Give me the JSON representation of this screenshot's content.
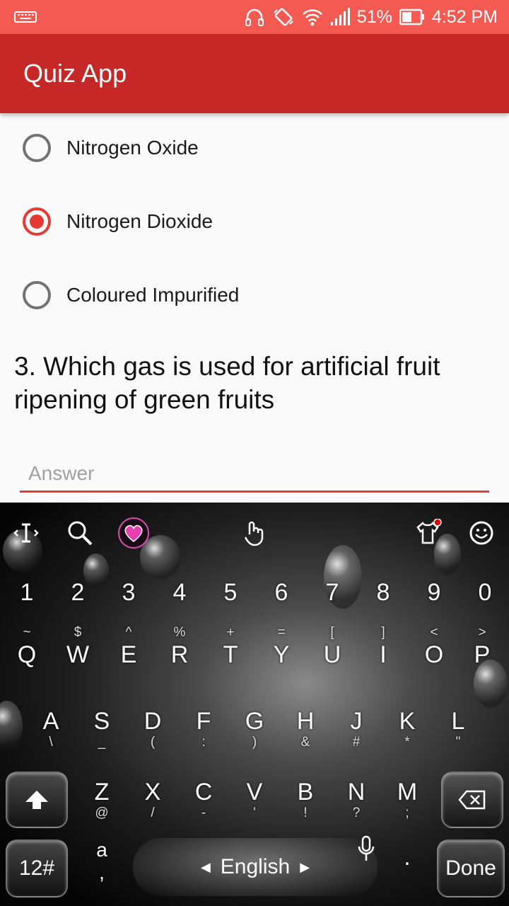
{
  "status_bar": {
    "battery_percent": "51%",
    "time": "4:52 PM",
    "icons": [
      "keyboard-icon",
      "headphones-icon",
      "vibrate-icon",
      "wifi-icon",
      "signal-icon",
      "battery-icon"
    ]
  },
  "app_bar": {
    "title": "Quiz App"
  },
  "options": [
    {
      "label": "Nitrogen Oxide",
      "checked": false
    },
    {
      "label": "Nitrogen Dioxide",
      "checked": true
    },
    {
      "label": "Coloured Impurified",
      "checked": false
    }
  ],
  "question": {
    "text": "3. Which gas is used for artificial fruit ripening of green fruits"
  },
  "answer": {
    "placeholder": "Answer",
    "value": ""
  },
  "keyboard": {
    "numbers": [
      "1",
      "2",
      "3",
      "4",
      "5",
      "6",
      "7",
      "8",
      "9",
      "0"
    ],
    "row1": [
      {
        "main": "Q",
        "sym": "~"
      },
      {
        "main": "W",
        "sym": "$"
      },
      {
        "main": "E",
        "sym": "^"
      },
      {
        "main": "R",
        "sym": "%"
      },
      {
        "main": "T",
        "sym": "+"
      },
      {
        "main": "Y",
        "sym": "="
      },
      {
        "main": "U",
        "sym": "["
      },
      {
        "main": "I",
        "sym": "]"
      },
      {
        "main": "O",
        "sym": "<"
      },
      {
        "main": "P",
        "sym": ">"
      }
    ],
    "row2": [
      {
        "main": "A",
        "sub": "\\"
      },
      {
        "main": "S",
        "sub": "_"
      },
      {
        "main": "D",
        "sub": "("
      },
      {
        "main": "F",
        "sub": ":"
      },
      {
        "main": "G",
        "sub": ")"
      },
      {
        "main": "H",
        "sub": "&"
      },
      {
        "main": "J",
        "sub": "#"
      },
      {
        "main": "K",
        "sub": "*"
      },
      {
        "main": "L",
        "sub": "\""
      }
    ],
    "row3": [
      {
        "main": "Z",
        "sub": "@"
      },
      {
        "main": "X",
        "sub": "/"
      },
      {
        "main": "C",
        "sub": "-"
      },
      {
        "main": "V",
        "sub": "'"
      },
      {
        "main": "B",
        "sub": "!"
      },
      {
        "main": "N",
        "sub": "?"
      },
      {
        "main": "M",
        "sub": ";"
      }
    ],
    "bottom": {
      "num_toggle": "12#",
      "lang_key_top": "a",
      "lang_key_sub": ",",
      "language": "English",
      "period": ".",
      "done": "Done"
    }
  },
  "colors": {
    "status_bar": "#f55a52",
    "app_bar": "#c62828",
    "accent": "#e53935"
  }
}
